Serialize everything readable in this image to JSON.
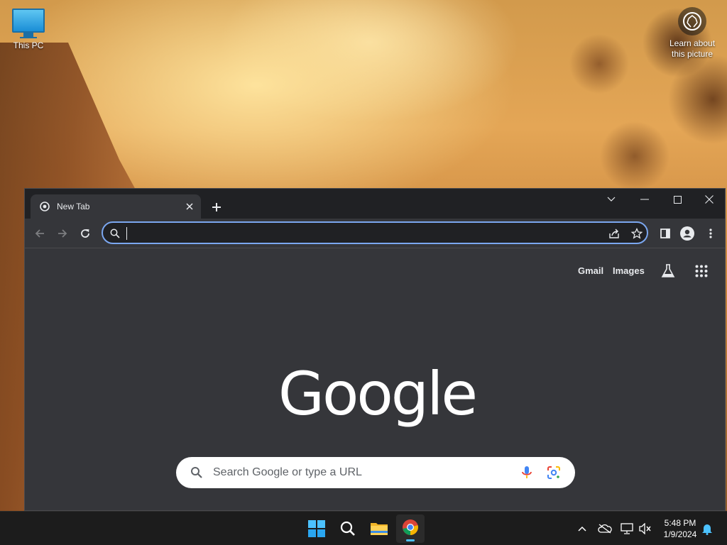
{
  "desktop": {
    "icons": [
      {
        "label": "This PC",
        "icon": "computer-icon"
      }
    ],
    "learn": {
      "label_line1": "Learn about",
      "label_line2": "this picture",
      "icon": "camera-icon"
    }
  },
  "browser": {
    "tab": {
      "title": "New Tab",
      "favicon": "chrome-icon"
    },
    "new_tab_icon": "plus-icon",
    "window_controls": [
      "chevron-down-icon",
      "minimize-icon",
      "maximize-icon",
      "close-icon"
    ],
    "toolbar": {
      "nav": [
        "back-icon",
        "forward-icon",
        "reload-icon"
      ],
      "omnibox": {
        "value": "",
        "icons": [
          "search-icon",
          "share-icon",
          "star-icon"
        ]
      },
      "right_icons": [
        "side-panel-icon",
        "profile-icon",
        "menu-icon"
      ]
    },
    "ntp": {
      "links": {
        "gmail": "Gmail",
        "images": "Images"
      },
      "labs_icon": "labs-flask-icon",
      "apps_icon": "apps-grid-icon",
      "logo_text": "Google",
      "search": {
        "placeholder": "Search Google or type a URL",
        "icons": [
          "search-icon",
          "mic-icon",
          "lens-icon"
        ]
      }
    }
  },
  "taskbar": {
    "apps": [
      "windows-start-icon",
      "search-icon",
      "file-explorer-icon",
      "chrome-icon"
    ],
    "active_app": "chrome-icon",
    "tray_icons": [
      "chevron-up-icon",
      "onedrive-icon",
      "network-icon",
      "volume-muted-icon"
    ],
    "clock": {
      "time": "5:48 PM",
      "date": "1/9/2024"
    },
    "notification_icon": "bell-icon"
  },
  "colors": {
    "titlebar": "#202124",
    "toolbar": "#35363a",
    "omnibox_focus": "#7ba7f0",
    "taskbar": "#1c1c1c",
    "accent": "#4cc2ff"
  }
}
